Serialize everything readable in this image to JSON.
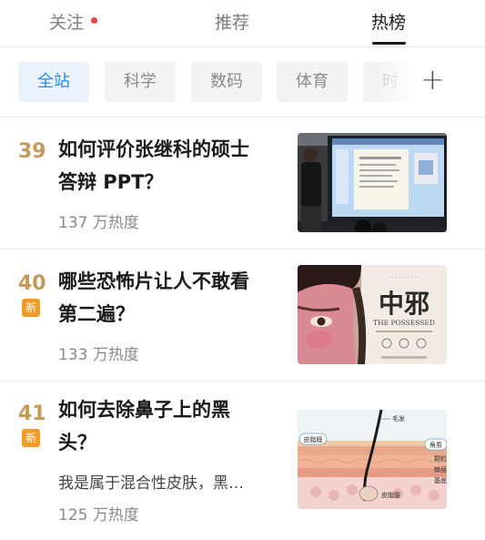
{
  "top_tabs": [
    {
      "label": "关注",
      "has_dot": true
    },
    {
      "label": "推荐"
    },
    {
      "label": "热榜",
      "active": true
    }
  ],
  "categories": [
    {
      "label": "全站",
      "active": true
    },
    {
      "label": "科学"
    },
    {
      "label": "数码"
    },
    {
      "label": "体育"
    },
    {
      "label": "时"
    }
  ],
  "add_icon": "plus-icon",
  "items": [
    {
      "rank": "39",
      "title_line1": "如何评价张继科的硕士",
      "title_line2": "答辩 PPT？",
      "heat": "137 万热度"
    },
    {
      "rank": "40",
      "badge": "新",
      "title_line1": "哪些恐怖片让人不敢看",
      "title_line2": "第二遍？",
      "heat": "133 万热度",
      "poster": {
        "title": "中邪",
        "subtitle": "THE POSSESSED"
      }
    },
    {
      "rank": "41",
      "badge": "新",
      "title_line1": "如何去除鼻子上的黑",
      "title_line2": "头？",
      "excerpt": "我是属于混合性皮肤，黑…",
      "heat": "125 万热度",
      "diagram": {
        "hair": "毛发",
        "epidermis": "皮脂膜",
        "horn": "角质",
        "particle": "颗粒",
        "spine": "棘层",
        "base": "基底",
        "gland": "皮脂腺"
      }
    }
  ],
  "colors": {
    "rank": "#c29a59",
    "badge": "#f29b26",
    "accent": "#2b8ae0",
    "dot": "#e8413b"
  }
}
